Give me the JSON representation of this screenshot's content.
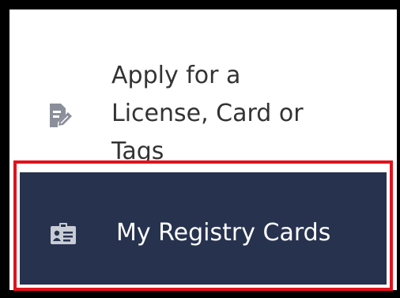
{
  "menu": {
    "apply_item": {
      "label": "Apply for a\nLicense, Card or\nTags",
      "icon": "document-edit-icon"
    },
    "registry_item": {
      "label": "My Registry Cards",
      "icon": "id-card-icon",
      "highlighted": true
    }
  },
  "colors": {
    "nav_background": "#27324f",
    "nav_text_active": "#ffffff",
    "nav_text": "#333333",
    "icon_gray": "#8a8f99",
    "highlight_border": "#e1121c"
  }
}
